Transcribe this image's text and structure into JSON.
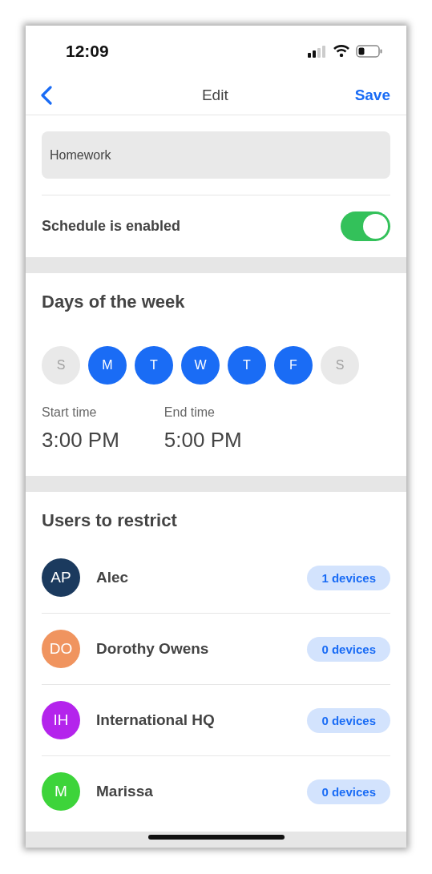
{
  "status_bar": {
    "time": "12:09"
  },
  "nav": {
    "title": "Edit",
    "action": "Save"
  },
  "name_field": {
    "value": "Homework"
  },
  "schedule": {
    "label": "Schedule is enabled",
    "on": true
  },
  "days": {
    "title": "Days of the week",
    "items": [
      {
        "label": "S",
        "selected": false
      },
      {
        "label": "M",
        "selected": true
      },
      {
        "label": "T",
        "selected": true
      },
      {
        "label": "W",
        "selected": true
      },
      {
        "label": "T",
        "selected": true
      },
      {
        "label": "F",
        "selected": true
      },
      {
        "label": "S",
        "selected": false
      }
    ]
  },
  "times": [
    {
      "label": "Start time",
      "value": "3:00 PM"
    },
    {
      "label": "End time",
      "value": "5:00 PM"
    }
  ],
  "users": {
    "title": "Users to restrict",
    "items": [
      {
        "initials": "AP",
        "name": "Alec",
        "devices": "1 devices",
        "color": "#1b3a5e"
      },
      {
        "initials": "DO",
        "name": "Dorothy Owens",
        "devices": "0 devices",
        "color": "#f0945f"
      },
      {
        "initials": "IH",
        "name": "International HQ",
        "devices": "0 devices",
        "color": "#b424ec"
      },
      {
        "initials": "M",
        "name": "Marissa",
        "devices": "0 devices",
        "color": "#3dd43a"
      }
    ]
  }
}
